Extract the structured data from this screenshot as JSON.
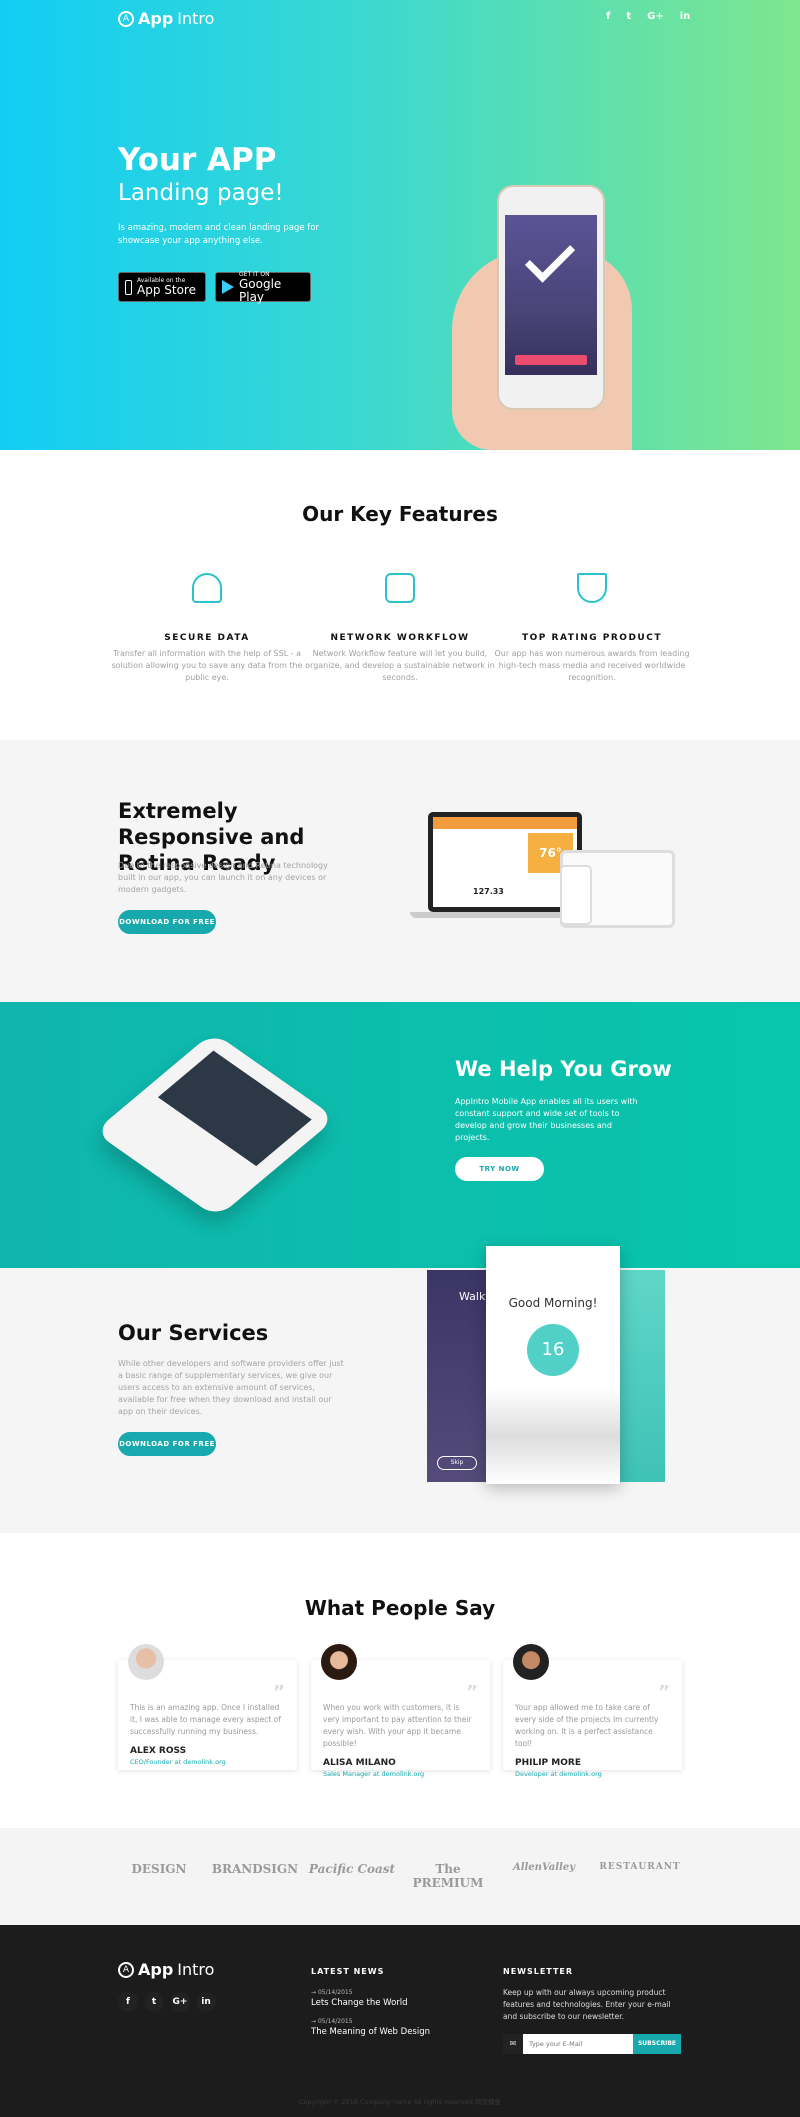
{
  "brand": {
    "bold": "App",
    "light": "Intro"
  },
  "social": {
    "facebook": "f",
    "twitter": "t",
    "google": "G+",
    "linkedin": "in"
  },
  "hero": {
    "title": "Your APP",
    "subtitle": "Landing page!",
    "text": "Is amazing, modern and clean landing page for showcase your app anything else.",
    "appstore": {
      "small": "Available on the",
      "big": "App Store"
    },
    "googleplay": {
      "small": "GET IT ON",
      "big": "Google Play"
    }
  },
  "features": {
    "title": "Our Key Features",
    "items": [
      {
        "icon": "cloud-lock-icon",
        "title": "SECURE DATA",
        "text": "Transfer all information with the help of SSL - a solution allowing you to save any data from the public eye."
      },
      {
        "icon": "network-folder-icon",
        "title": "NETWORK WORKFLOW",
        "text": "Network Workflow feature will let you build, organize, and develop a sustainable network in seconds."
      },
      {
        "icon": "medal-icon",
        "title": "TOP RATING PRODUCT",
        "text": "Our app has won numerous awards from leading high-tech mass media and received worldwide recognition."
      }
    ]
  },
  "responsive": {
    "title": "Extremely Responsive and Retina Ready",
    "text": "Due to the responsive design and Retina technology built in our app, you can launch it on any devices or modern gadgets.",
    "button": "DOWNLOAD FOR FREE",
    "screen_values": [
      "76°",
      "127.33"
    ]
  },
  "grow": {
    "title": "We Help You Grow",
    "text": "AppIntro Mobile App enables all its users with constant support and wide set of tools to develop and grow their businesses and projects.",
    "button": "TRY NOW"
  },
  "services": {
    "title": "Our Services",
    "text": "While other developers and software providers offer just a basic range of supplementary services, we give our users access to an extensive amount of services, available for free when they download and install our app on their devices.",
    "button": "DOWNLOAD FOR FREE",
    "mock": {
      "greeting": "Good Morning!",
      "temp": "16",
      "left": "Walkt",
      "skip": "Skip"
    }
  },
  "testimonials": {
    "title": "What People Say",
    "items": [
      {
        "text": "This is an amazing app. Once I installed it, I was able to manage every aspect of successfully running my business.",
        "name": "ALEX ROSS",
        "role": "CEO/Founder at demolink.org"
      },
      {
        "text": "When you work with customers, it is very important to pay attention to their every wish. With your app it became possible!",
        "name": "ALISA MILANO",
        "role": "Sales Manager at demolink.org"
      },
      {
        "text": "Your app allowed me to take care of every side of the projects Im currently working on. It is a perfect assistance tool!",
        "name": "PHILIP MORE",
        "role": "Developer at demolink.org"
      }
    ]
  },
  "partners": [
    "DESIGN",
    "BRANDSIGN",
    "Pacific Coast",
    "The PREMIUM",
    "AllenValley",
    "RESTAURANT"
  ],
  "footer": {
    "news_title": "LATEST NEWS",
    "news": [
      {
        "date": "05/14/2015",
        "title": "Lets Change the World"
      },
      {
        "date": "05/14/2015",
        "title": "The Meaning of Web Design"
      }
    ],
    "newsletter_title": "NEWSLETTER",
    "newsletter_text": "Keep up with our always upcoming product features and technologies. Enter your e-mail and subscribe to our newsletter.",
    "email_placeholder": "Type your E-Mail",
    "subscribe": "SUBSCRIBE",
    "copyright": "Copyright © 2018 Company name All rights reserved.网页模板"
  },
  "colors": {
    "accent": "#17a9ad",
    "footer_bg": "#1c1c1c",
    "hero_start": "#12cdf5",
    "hero_end": "#7ee68e"
  }
}
